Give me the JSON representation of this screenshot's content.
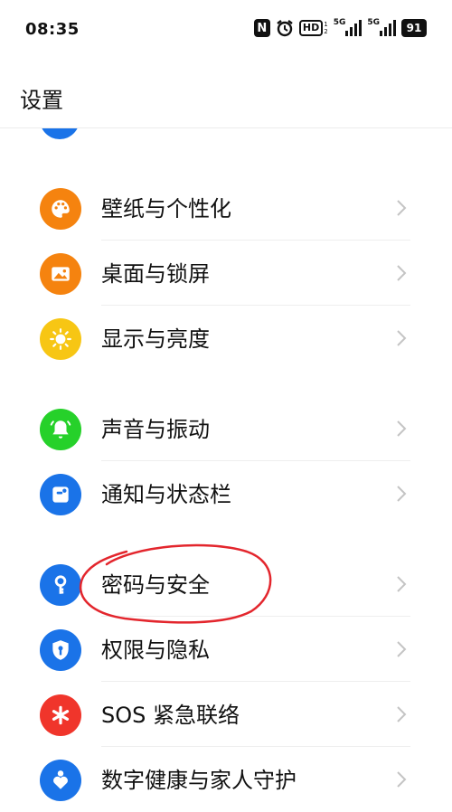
{
  "status_bar": {
    "time": "08:35",
    "hd_label": "HD",
    "hd_sub_top": "1",
    "hd_sub_bottom": "2",
    "net_label_1": "5G",
    "net_label_2": "5G",
    "battery": "91",
    "icons": [
      "nfc-icon",
      "alarm-icon",
      "hd-icon",
      "signal-icon",
      "signal-icon",
      "battery-icon"
    ]
  },
  "header": {
    "title": "设置"
  },
  "settings": {
    "items": [
      {
        "label": "壁纸与个性化",
        "icon": "palette-icon",
        "color": "#f5830f"
      },
      {
        "label": "桌面与锁屏",
        "icon": "image-icon",
        "color": "#f5830f"
      },
      {
        "label": "显示与亮度",
        "icon": "sun-icon",
        "color": "#f7c614"
      },
      {
        "label": "声音与振动",
        "icon": "bell-icon",
        "color": "#26d12a"
      },
      {
        "label": "通知与状态栏",
        "icon": "notification-icon",
        "color": "#1a73e8"
      },
      {
        "label": "密码与安全",
        "icon": "key-icon",
        "color": "#1a73e8"
      },
      {
        "label": "权限与隐私",
        "icon": "shield-icon",
        "color": "#1a73e8"
      },
      {
        "label": "SOS 紧急联络",
        "icon": "asterisk-icon",
        "color": "#f0352b"
      },
      {
        "label": "数字健康与家人守护",
        "icon": "family-icon",
        "color": "#1a73e8"
      }
    ]
  },
  "annotation": {
    "color": "#e3262d"
  }
}
